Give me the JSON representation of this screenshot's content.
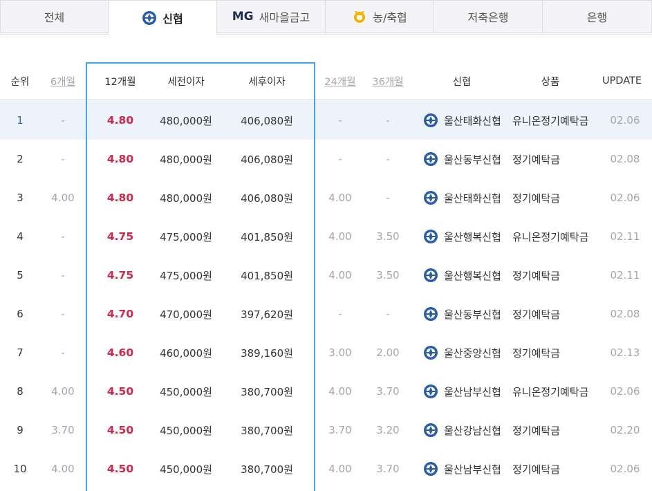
{
  "tabs": [
    {
      "label": "전체",
      "icon": "",
      "active": false
    },
    {
      "label": "신협",
      "icon": "shinhyup-logo-icon",
      "active": true
    },
    {
      "label": "새마을금고",
      "prefix": "MG",
      "icon": "mg-logo-icon",
      "active": false
    },
    {
      "label": "농/축협",
      "icon": "nonghyup-logo-icon",
      "active": false
    },
    {
      "label": "저축은행",
      "icon": "",
      "active": false
    },
    {
      "label": "은행",
      "icon": "",
      "active": false
    }
  ],
  "table": {
    "headers": {
      "rank": "순위",
      "m6": "6개월",
      "m12": "12개월",
      "pretax": "세전이자",
      "aftertax": "세후이자",
      "m24": "24개월",
      "m36": "36개월",
      "institution": "신협",
      "product": "상품",
      "update": "UPDATE"
    },
    "rows": [
      {
        "rank": "1",
        "m6": "-",
        "m12": "4.80",
        "pretax": "480,000원",
        "aftertax": "406,080원",
        "m24": "-",
        "m36": "-",
        "institution": "울산태화신협",
        "product": "유니온정기예탁금",
        "update": "02.06"
      },
      {
        "rank": "2",
        "m6": "-",
        "m12": "4.80",
        "pretax": "480,000원",
        "aftertax": "406,080원",
        "m24": "-",
        "m36": "-",
        "institution": "울산동부신협",
        "product": "정기예탁금",
        "update": "02.08"
      },
      {
        "rank": "3",
        "m6": "4.00",
        "m12": "4.80",
        "pretax": "480,000원",
        "aftertax": "406,080원",
        "m24": "4.00",
        "m36": "-",
        "institution": "울산태화신협",
        "product": "정기예탁금",
        "update": "02.06"
      },
      {
        "rank": "4",
        "m6": "-",
        "m12": "4.75",
        "pretax": "475,000원",
        "aftertax": "401,850원",
        "m24": "4.00",
        "m36": "3.50",
        "institution": "울산행복신협",
        "product": "유니온정기예탁금",
        "update": "02.11"
      },
      {
        "rank": "5",
        "m6": "-",
        "m12": "4.75",
        "pretax": "475,000원",
        "aftertax": "401,850원",
        "m24": "4.00",
        "m36": "3.50",
        "institution": "울산행복신협",
        "product": "정기예탁금",
        "update": "02.11"
      },
      {
        "rank": "6",
        "m6": "-",
        "m12": "4.70",
        "pretax": "470,000원",
        "aftertax": "397,620원",
        "m24": "-",
        "m36": "-",
        "institution": "울산동부신협",
        "product": "정기예탁금",
        "update": "02.08"
      },
      {
        "rank": "7",
        "m6": "-",
        "m12": "4.60",
        "pretax": "460,000원",
        "aftertax": "389,160원",
        "m24": "3.00",
        "m36": "2.00",
        "institution": "울산중앙신협",
        "product": "정기예탁금",
        "update": "02.13"
      },
      {
        "rank": "8",
        "m6": "4.00",
        "m12": "4.50",
        "pretax": "450,000원",
        "aftertax": "380,700원",
        "m24": "4.00",
        "m36": "3.70",
        "institution": "울산남부신협",
        "product": "유니온정기예탁금",
        "update": "02.06"
      },
      {
        "rank": "9",
        "m6": "3.70",
        "m12": "4.50",
        "pretax": "450,000원",
        "aftertax": "380,700원",
        "m24": "3.70",
        "m36": "3.20",
        "institution": "울산강남신협",
        "product": "정기예탁금",
        "update": "02.20"
      },
      {
        "rank": "10",
        "m6": "4.00",
        "m12": "4.50",
        "pretax": "450,000원",
        "aftertax": "380,700원",
        "m24": "4.00",
        "m36": "3.70",
        "institution": "울산남부신협",
        "product": "정기예탁금",
        "update": "02.06"
      }
    ]
  },
  "colors": {
    "accent_rate": "#d3264a",
    "frame_blue": "#4aa4e8",
    "highlight_row": "#edf3fb",
    "rank_highlight": "#2e6fb3",
    "shinhyup_logo": "#2b5ea8",
    "nonghyup_logo": "#f0b400"
  }
}
